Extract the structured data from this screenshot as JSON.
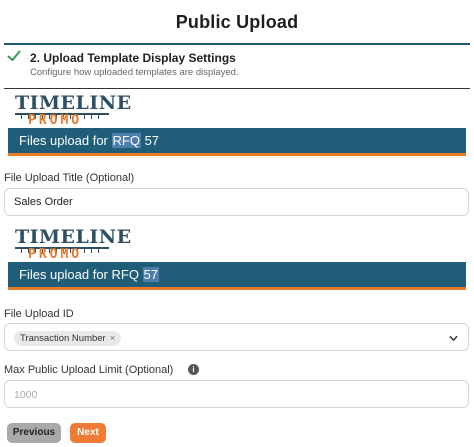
{
  "dialog": {
    "title": "Public Upload"
  },
  "step": {
    "title": "2. Upload Template Display Settings",
    "subtitle": "Configure how uploaded templates are displayed."
  },
  "banner_top": {
    "logo_line1": "TIMELINE",
    "logo_line2": "PROMO",
    "text_before": "Files upload for ",
    "text_highlight": "RFQ",
    "text_after": " 57"
  },
  "banner_bottom": {
    "logo_line1": "TIMELINE",
    "logo_line2": "PROMO",
    "text_before": "Files upload for RFQ ",
    "text_highlight": "57"
  },
  "fields": {
    "upload_title": {
      "label": "File Upload Title (Optional)",
      "value": "Sales Order"
    },
    "upload_id": {
      "label": "File Upload ID",
      "chip": "Transaction Number",
      "chip_remove": "×"
    },
    "limit": {
      "label": "Max Public Upload Limit  (Optional)",
      "placeholder": "1000",
      "info": "i"
    }
  },
  "buttons": {
    "previous": "Previous",
    "next": "Next"
  },
  "colors": {
    "accent": "#1f5d78",
    "orange": "#ee7d33",
    "check": "#2e9a4e"
  }
}
